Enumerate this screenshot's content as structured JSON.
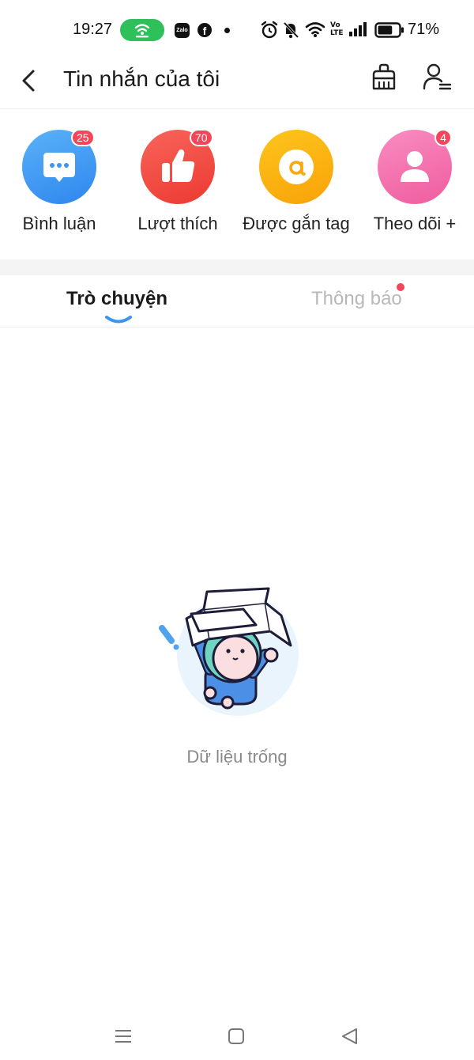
{
  "status_bar": {
    "time": "19:27",
    "zalo_label": "Zalo",
    "facebook_label": "f",
    "battery_percent": "71%",
    "battery_level": 0.71,
    "network_label": "Vo LTE",
    "icons": [
      "hotspot-icon",
      "zalo-icon",
      "facebook-icon",
      "alarm-icon",
      "mute-icon",
      "wifi-icon",
      "volte-icon",
      "signal-icon",
      "battery-icon"
    ]
  },
  "header": {
    "title": "Tin nhắn của tôi",
    "icons": [
      "back-arrow-icon",
      "clear-broom-icon",
      "user-settings-icon"
    ]
  },
  "shortcuts": [
    {
      "label": "Bình luận",
      "badge": "25",
      "color": "#3d95f2",
      "icon": "comment-bubble-icon"
    },
    {
      "label": "Lượt thích",
      "badge": "70",
      "color": "#f2483c",
      "icon": "thumbs-up-icon"
    },
    {
      "label": "Được gắn tag",
      "badge": "",
      "color": "#fbb20e",
      "icon": "at-sign-icon"
    },
    {
      "label": "Theo dõi +",
      "badge": "4",
      "color": "#f36fab",
      "icon": "person-icon"
    }
  ],
  "tabs": [
    {
      "label": "Trò chuyện",
      "active": true
    },
    {
      "label": "Thông báo",
      "active": false,
      "has_dot": true
    }
  ],
  "empty_state": {
    "text": "Dữ liệu trống",
    "icon": "empty-box-character-icon"
  },
  "nav_bar": {
    "icons": [
      "menu-icon",
      "home-square-icon",
      "back-triangle-icon"
    ]
  },
  "colors": {
    "accent_blue": "#3d95f2",
    "badge_red": "#f4465a",
    "hotspot_green": "#2fbf5b"
  }
}
